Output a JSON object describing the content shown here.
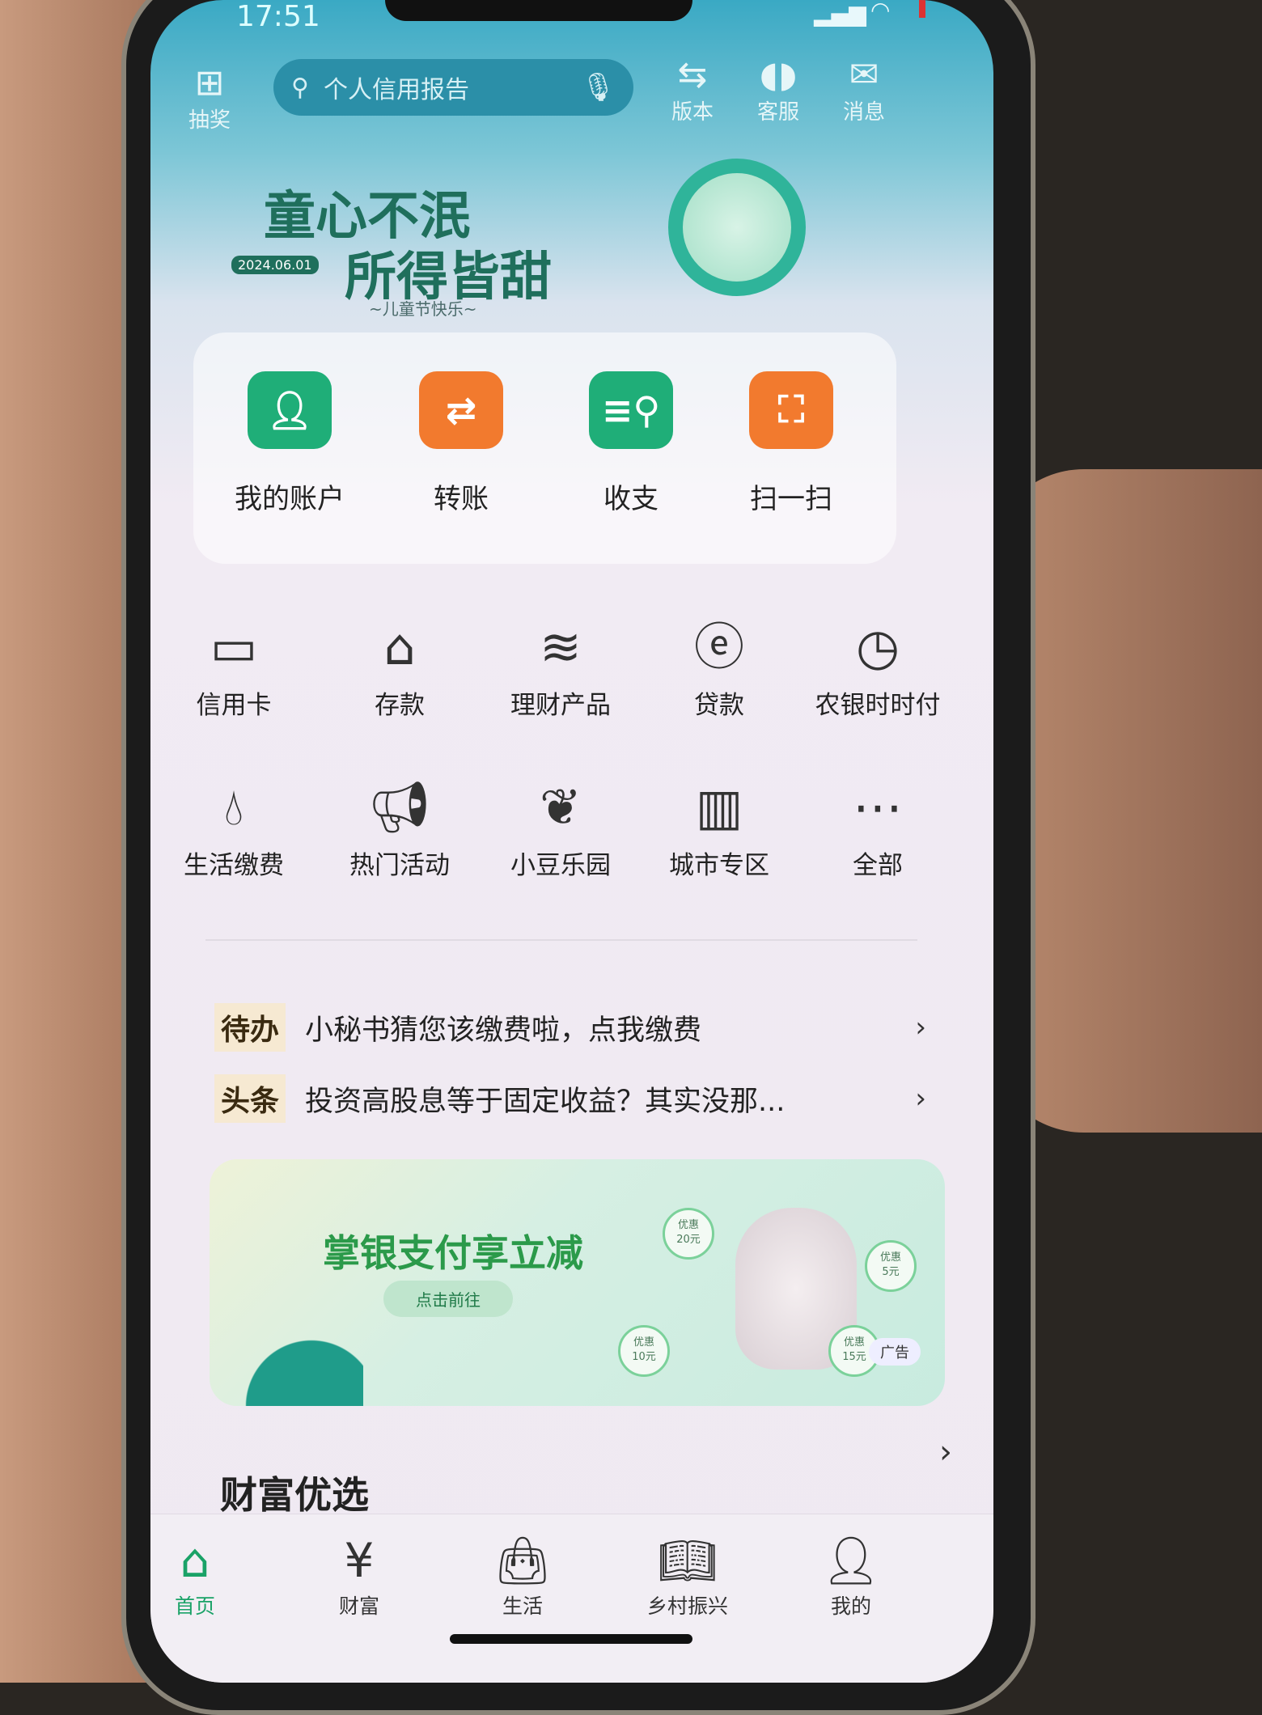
{
  "status": {
    "time": "17:51"
  },
  "topbar": {
    "lottery": {
      "label": "抽奖",
      "icon": "gift-icon"
    },
    "search": {
      "placeholder": "个人信用报告",
      "icon": "search-icon",
      "mic_icon": "microphone-icon"
    },
    "version": {
      "label": "版本",
      "icon": "version-switch-icon"
    },
    "service": {
      "label": "客服",
      "icon": "headset-icon"
    },
    "messages": {
      "label": "消息",
      "icon": "envelope-icon"
    }
  },
  "banner": {
    "line1": "童心不泯",
    "line2": "所得皆甜",
    "date": "2024.06.01",
    "subtitle": "~儿童节快乐~"
  },
  "quick": [
    {
      "label": "我的账户",
      "icon": "account-icon",
      "color": "#1fae78"
    },
    {
      "label": "转账",
      "icon": "transfer-icon",
      "color": "#f27a2e"
    },
    {
      "label": "收支",
      "icon": "bill-search-icon",
      "color": "#1fae78"
    },
    {
      "label": "扫一扫",
      "icon": "scan-icon",
      "color": "#f27a2e"
    }
  ],
  "grid": [
    {
      "label": "信用卡",
      "icon": "credit-card-icon"
    },
    {
      "label": "存款",
      "icon": "deposit-house-icon"
    },
    {
      "label": "理财产品",
      "icon": "coins-stack-icon"
    },
    {
      "label": "贷款",
      "icon": "money-bag-icon"
    },
    {
      "label": "农银时时付",
      "icon": "clock-yuan-icon"
    },
    {
      "label": "生活缴费",
      "icon": "water-drop-icon"
    },
    {
      "label": "热门活动",
      "icon": "megaphone-icon"
    },
    {
      "label": "小豆乐园",
      "icon": "bean-icon"
    },
    {
      "label": "城市专区",
      "icon": "building-icon"
    },
    {
      "label": "全部",
      "icon": "more-dots-icon"
    }
  ],
  "notices": [
    {
      "badge": "待办",
      "text": "小秘书猜您该缴费啦，点我缴费"
    },
    {
      "badge": "头条",
      "text": "投资高股息等于固定收益？其实没那..."
    }
  ],
  "ad": {
    "title": "掌银支付享立减",
    "button": "点击前往",
    "tag": "广告",
    "coupons": [
      {
        "label": "优惠",
        "amount": "20元"
      },
      {
        "label": "优惠",
        "amount": "5元"
      },
      {
        "label": "优惠",
        "amount": "10元"
      },
      {
        "label": "优惠",
        "amount": "15元"
      }
    ]
  },
  "section": {
    "title": "财富优选"
  },
  "nav": [
    {
      "label": "首页",
      "icon": "home-icon",
      "active": true
    },
    {
      "label": "财富",
      "icon": "yuan-circle-icon"
    },
    {
      "label": "生活",
      "icon": "shopping-bag-icon"
    },
    {
      "label": "乡村振兴",
      "icon": "book-icon"
    },
    {
      "label": "我的",
      "icon": "user-icon"
    }
  ]
}
